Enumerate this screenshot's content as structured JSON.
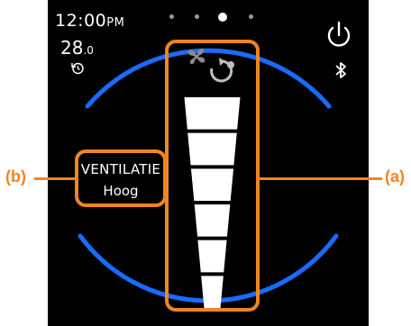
{
  "status": {
    "clock": "12:00",
    "clock_suffix": "PM",
    "temperature": "28",
    "temperature_decimal": ".0"
  },
  "pager": {
    "pages": 4,
    "active_index": 2
  },
  "icons": {
    "timer": "timer-icon",
    "power": "power-icon",
    "bluetooth": "bluetooth-icon",
    "fan": "fan-icon",
    "auto": "auto-mode-icon"
  },
  "ventilation": {
    "label": "VENTILATIE",
    "value": "Hoog",
    "levels_total": 6,
    "levels_filled": 6
  },
  "callouts": {
    "a": "(a)",
    "b": "(b)"
  },
  "colors": {
    "accent": "#f08520",
    "ring": "#1a6bff",
    "background": "#000000",
    "foreground": "#ffffff"
  }
}
